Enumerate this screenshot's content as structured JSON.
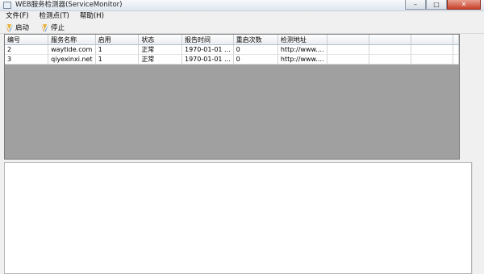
{
  "window": {
    "title": "WEB服务检测器(ServiceMonitor)",
    "controls": {
      "minimize": "–",
      "maximize": "□",
      "close": "✕"
    }
  },
  "menu": [
    "文件(F)",
    "检测点(T)",
    "帮助(H)"
  ],
  "toolbar": {
    "start_label": "启动",
    "stop_label": "停止"
  },
  "grid": {
    "columns": [
      "编号",
      "服务名称",
      "启用",
      "状态",
      "报告时间",
      "重启次数",
      "检测地址",
      "",
      "",
      "",
      ""
    ],
    "rows": [
      [
        "2",
        "waytide.com",
        "1",
        "正常",
        "1970-01-01 ...",
        "0",
        "http://www....",
        "",
        "",
        "",
        ""
      ],
      [
        "3",
        "qiyexinxi.net",
        "1",
        "正常",
        "1970-01-01 ...",
        "0",
        "http://www....",
        "",
        "",
        "",
        ""
      ]
    ]
  },
  "colors": {
    "grid_background": "#a0a0a0",
    "titlebar": "#dfe6ef",
    "close_button": "#c8412a"
  }
}
